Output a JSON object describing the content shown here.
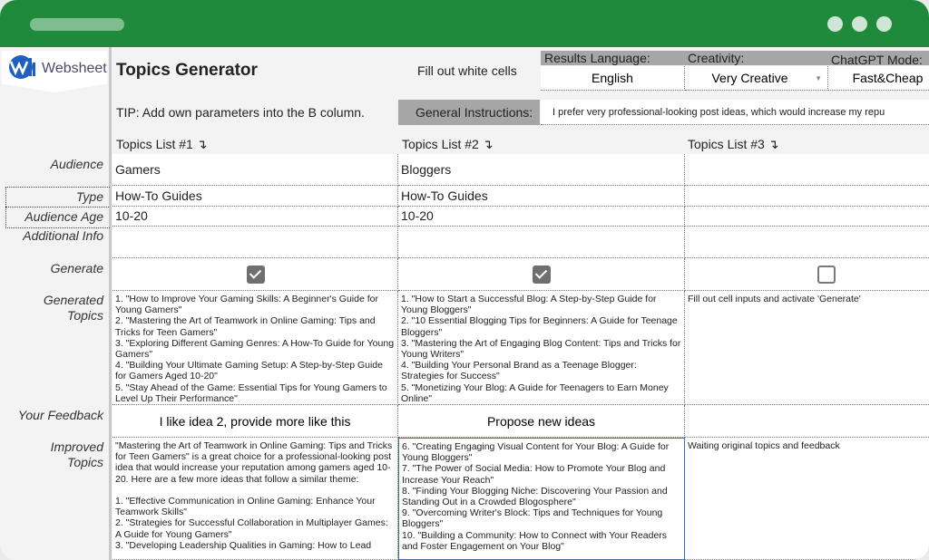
{
  "app": {
    "logo_text": "Websheet"
  },
  "header": {
    "title": "Topics Generator",
    "fill_hint": "Fill out white cells",
    "results_language_label": "Results Language:",
    "results_language_value": "English",
    "creativity_label": "Creativity:",
    "creativity_value": "Very Creative",
    "mode_label": "ChatGPT Mode:",
    "mode_value": "Fast&Cheap",
    "tip": "TIP: Add own parameters into the B column.",
    "general_instructions_label": "General Instructions:",
    "general_instructions_value": "I prefer very professional-looking post ideas, which would increase my repu"
  },
  "row_labels": {
    "audience": "Audience",
    "type": "Type",
    "audience_age": "Audience Age",
    "additional_info": "Additional Info",
    "generate": "Generate",
    "generated_topics_1": "Generated",
    "generated_topics_2": "Topics",
    "feedback": "Your Feedback",
    "improved_topics_1": "Improved",
    "improved_topics_2": "Topics"
  },
  "columns": [
    {
      "header": "Topics List #1 ↴",
      "audience": "Gamers",
      "type": "How-To Guides",
      "age": "10-20",
      "additional_info": "",
      "generate": true,
      "generated": "1. \"How to Improve Your Gaming Skills: A Beginner's Guide for Young Gamers\"\n2. \"Mastering the Art of Teamwork in Online Gaming: Tips and Tricks for Teen Gamers\"\n3. \"Exploring Different Gaming Genres: A How-To Guide for Young Gamers\"\n4. \"Building Your Ultimate Gaming Setup: A Step-by-Step Guide for Gamers Aged 10-20\"\n5. \"Stay Ahead of the Game: Essential Tips for Young Gamers to Level Up Their Performance\"",
      "feedback": "I like idea 2, provide more like this",
      "improved": "\"Mastering the Art of Teamwork in Online Gaming: Tips and Tricks for Teen Gamers\" is a great choice for a professional-looking post idea that would increase your reputation among gamers aged 10-20. Here are a few more ideas that follow a similar theme:\n\n1. \"Effective Communication in Online Gaming: Enhance Your Teamwork Skills\"\n2. \"Strategies for Successful Collaboration in Multiplayer Games: A Guide for Young Gamers\"\n3. \"Developing Leadership Qualities in Gaming: How to Lead"
    },
    {
      "header": "Topics List #2 ↴",
      "audience": "Bloggers",
      "type": "How-To Guides",
      "age": "10-20",
      "additional_info": "",
      "generate": true,
      "generated": "1. \"How to Start a Successful Blog: A Step-by-Step Guide for Young Bloggers\"\n2. \"10 Essential Blogging Tips for Beginners: A Guide for Teenage Bloggers\"\n3. \"Mastering the Art of Engaging Blog Content: Tips and Tricks for Young Writers\"\n4. \"Building Your Personal Brand as a Teenage Blogger: Strategies for Success\"\n5. \"Monetizing Your Blog: A Guide for Teenagers to Earn Money Online\"",
      "feedback": "Propose new ideas",
      "improved": "6. \"Creating Engaging Visual Content for Your Blog: A Guide for Young Bloggers\"\n7. \"The Power of Social Media: How to Promote Your Blog and Increase Your Reach\"\n8. \"Finding Your Blogging Niche: Discovering Your Passion and Standing Out in a Crowded Blogosphere\"\n9. \"Overcoming Writer's Block: Tips and Techniques for Young Bloggers\"\n10. \"Building a Community: How to Connect with Your Readers and Foster Engagement on Your Blog\""
    },
    {
      "header": "Topics List #3 ↴",
      "audience": "",
      "type": "",
      "age": "",
      "additional_info": "",
      "generate": false,
      "generated": "Fill out cell inputs and activate 'Generate'",
      "feedback": "",
      "improved": "Waiting original topics and feedback"
    }
  ],
  "colors": {
    "titlebar": "#1f8a3c",
    "selection": "#2f6fd6",
    "label_fill": "#a6a6a6"
  }
}
